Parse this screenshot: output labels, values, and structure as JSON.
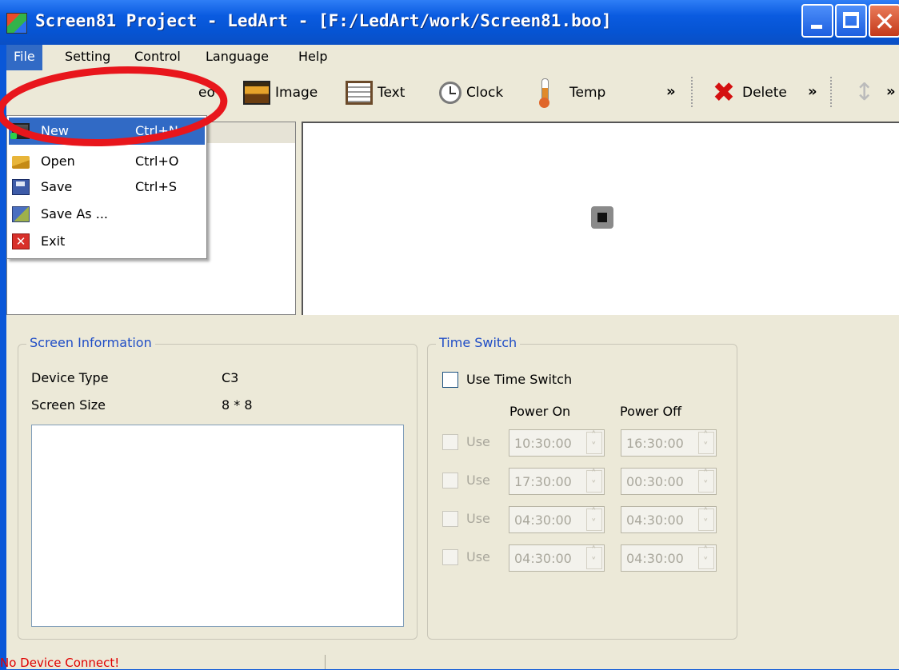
{
  "window": {
    "title": "Screen81 Project - LedArt - [F:/LedArt/work/Screen81.boo]",
    "accent_color": "#0a57d8"
  },
  "menu": [
    {
      "label": "File"
    },
    {
      "label": "Setting"
    },
    {
      "label": "Control"
    },
    {
      "label": "Language"
    },
    {
      "label": "Help"
    }
  ],
  "toolbar": {
    "video_partial": "eo",
    "image": "Image",
    "text": "Text",
    "clock": "Clock",
    "temp": "Temp",
    "delete": "Delete",
    "more": "»"
  },
  "file_menu": [
    {
      "label": "New",
      "shortcut": "Ctrl+N",
      "icon": "new-screen-icon"
    },
    {
      "label": "Open",
      "shortcut": "Ctrl+O",
      "icon": "folder-open-icon"
    },
    {
      "label": "Save",
      "shortcut": "Ctrl+S",
      "icon": "floppy-disk-icon"
    },
    {
      "label": "Save As ...",
      "shortcut": "",
      "icon": "save-as-icon"
    },
    {
      "label": "Exit",
      "shortcut": "",
      "icon": "exit-icon"
    }
  ],
  "screen_info": {
    "title": "Screen Information",
    "device_type_label": "Device Type",
    "device_type_value": "C3",
    "screen_size_label": "Screen Size",
    "screen_size_value": "8 * 8"
  },
  "time_switch": {
    "title": "Time Switch",
    "use_label": "Use Time Switch",
    "enabled": false,
    "power_on_header": "Power On",
    "power_off_header": "Power Off",
    "rows": [
      {
        "use": "Use",
        "on": "10:30:00",
        "off": "16:30:00"
      },
      {
        "use": "Use",
        "on": "17:30:00",
        "off": "00:30:00"
      },
      {
        "use": "Use",
        "on": "04:30:00",
        "off": "04:30:00"
      },
      {
        "use": "Use",
        "on": "04:30:00",
        "off": "04:30:00"
      }
    ]
  },
  "status": {
    "text": "No Device Connect!",
    "color": "#e00000"
  },
  "annotation": {
    "color": "#e8161c"
  }
}
